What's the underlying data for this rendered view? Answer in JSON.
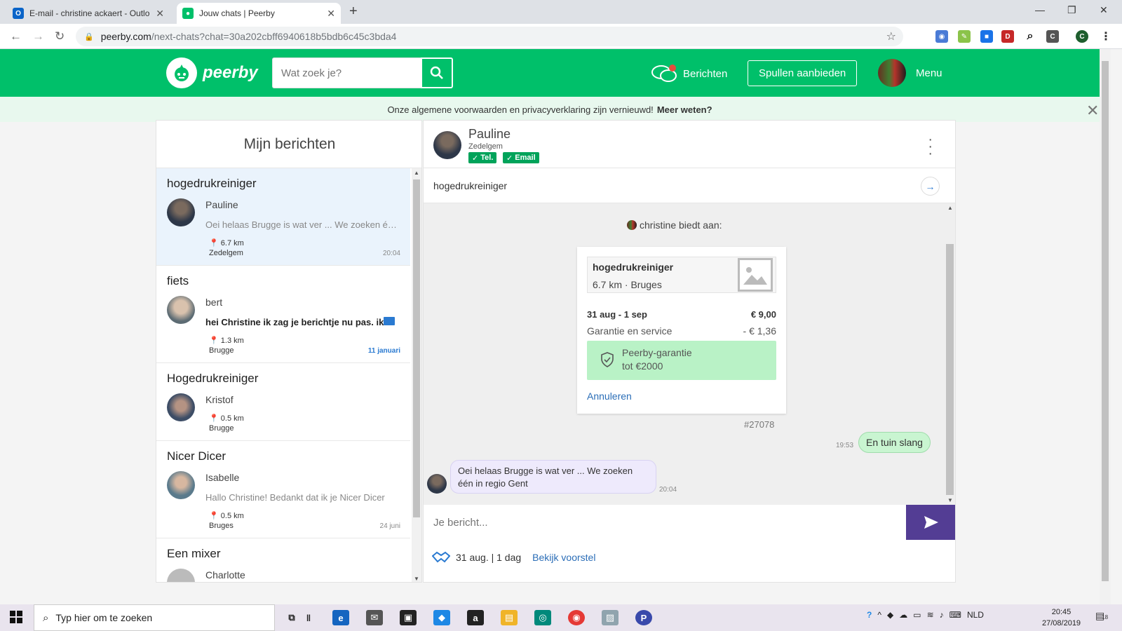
{
  "browser": {
    "tabs": [
      {
        "title": "E-mail - christine ackaert - Outlo",
        "favicon": "outlook-icon",
        "active": false
      },
      {
        "title": "Jouw chats | Peerby",
        "favicon": "peerby-icon",
        "active": true
      }
    ],
    "address_host": "peerby.com",
    "address_path": "/next-chats?chat=30a202cbff6940618b5bdb6c45c3bda4",
    "profile_letter": "C"
  },
  "header": {
    "logo_text": "peerby",
    "search_placeholder": "Wat zoek je?",
    "messages_label": "Berichten",
    "offer_button": "Spullen aanbieden",
    "menu_label": "Menu"
  },
  "notice": {
    "text": "Onze algemene voorwaarden en privacyverklaring zijn vernieuwd!",
    "link": "Meer weten?"
  },
  "inbox": {
    "title": "Mijn berichten",
    "conversations": [
      {
        "item": "hogedrukreiniger",
        "user": "Pauline",
        "preview": "Oei helaas Brugge is wat ver ... We zoeken één in regio Gent",
        "distance": "6.7 km",
        "city": "Zedelgem",
        "time": "20:04",
        "selected": true,
        "unread": false
      },
      {
        "item": "fiets",
        "user": "bert",
        "preview": "hei Christine ik zag je berichtje nu pas. ik",
        "distance": "1.3 km",
        "city": "Brugge",
        "time": "11 januari",
        "selected": false,
        "unread": true
      },
      {
        "item": "Hogedrukreiniger",
        "user": "Kristof",
        "preview": "",
        "distance": "0.5 km",
        "city": "Brugge",
        "time": "",
        "selected": false,
        "unread": false
      },
      {
        "item": "Nicer Dicer",
        "user": "Isabelle",
        "preview": "Hallo Christine! Bedankt dat ik je Nicer Dicer",
        "distance": "0.5 km",
        "city": "Bruges",
        "time": "24 juni",
        "selected": false,
        "unread": false
      },
      {
        "item": "Een mixer",
        "user": "Charlotte",
        "preview": "",
        "distance": "",
        "city": "",
        "time": "",
        "selected": false,
        "unread": false
      }
    ]
  },
  "chat": {
    "name": "Pauline",
    "city": "Zedelgem",
    "badges": [
      "Tel.",
      "Email"
    ],
    "item_title": "hogedrukreiniger",
    "offer_label": "christine biedt aan:",
    "card": {
      "item": "hogedrukreiniger",
      "subtitle": "6.7 km · Bruges",
      "dates": "31 aug - 1 sep",
      "price": "€ 9,00",
      "guarantee_label": "Garantie en service",
      "guarantee_value": "- € 1,36",
      "box_line1": "Peerby-garantie",
      "box_line2": "tot €2000",
      "cancel": "Annuleren",
      "reference": "#27078"
    },
    "messages": [
      {
        "text": "En tuin slang",
        "time": "19:53",
        "from": "me"
      },
      {
        "text": "Oei helaas Brugge is wat ver ... We zoeken één in regio Gent",
        "time": "20:04",
        "from": "them"
      }
    ],
    "input_placeholder": "Je bericht...",
    "proposal_text": "31 aug. | 1 dag",
    "proposal_link": "Bekijk voorstel"
  },
  "taskbar": {
    "search_placeholder": "Typ hier om te zoeken",
    "language": "NLD",
    "time": "20:45",
    "date": "27/08/2019",
    "notification_count": "18"
  },
  "colors": {
    "brand_green": "#00c06a",
    "send_purple": "#533d94",
    "link_blue": "#2a6db7"
  }
}
